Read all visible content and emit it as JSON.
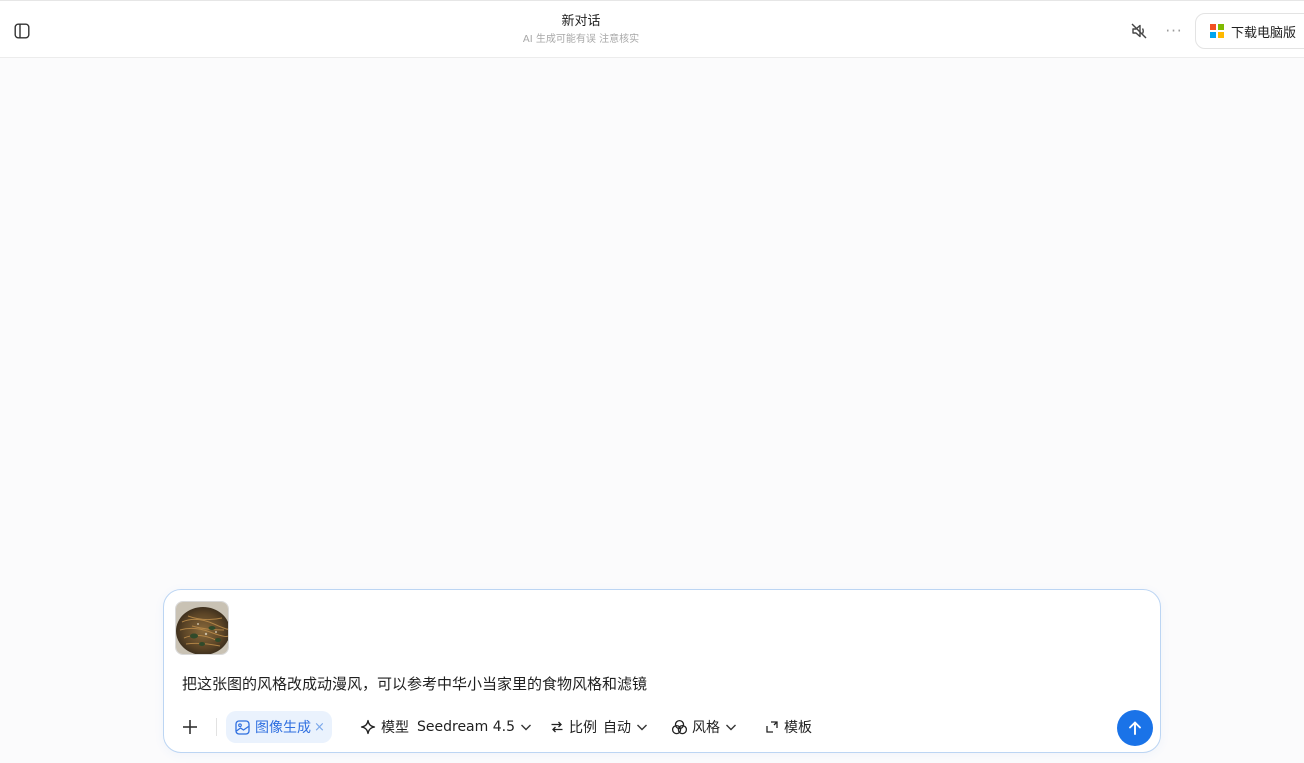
{
  "header": {
    "title": "新对话",
    "subtitle": "AI 生成可能有误 注意核实",
    "download_label": "下载电脑版",
    "more_label": "···",
    "icons": {
      "sidebar": "sidebar-toggle-icon",
      "mute": "speaker-muted-icon",
      "download": "windows-logo-icon"
    }
  },
  "composer": {
    "attachment": {
      "type": "image-thumbnail",
      "description_icon": "food-photo-icon"
    },
    "prompt": "把这张图的风格改成动漫风，可以参考中华小当家里的食物风格和滤镜",
    "mode_chip": {
      "label": "图像生成",
      "close": "×"
    },
    "tools": {
      "model": {
        "label": "模型",
        "value": "Seedream 4.5"
      },
      "ratio": {
        "label": "比例",
        "value": "自动"
      },
      "style": {
        "label": "风格"
      },
      "template": {
        "label": "模板"
      }
    }
  },
  "colors": {
    "accent": "#1a73e8",
    "chip_bg": "#eaf2fd",
    "chip_text": "#2f6fe0",
    "composer_border": "#bcd5f3"
  }
}
